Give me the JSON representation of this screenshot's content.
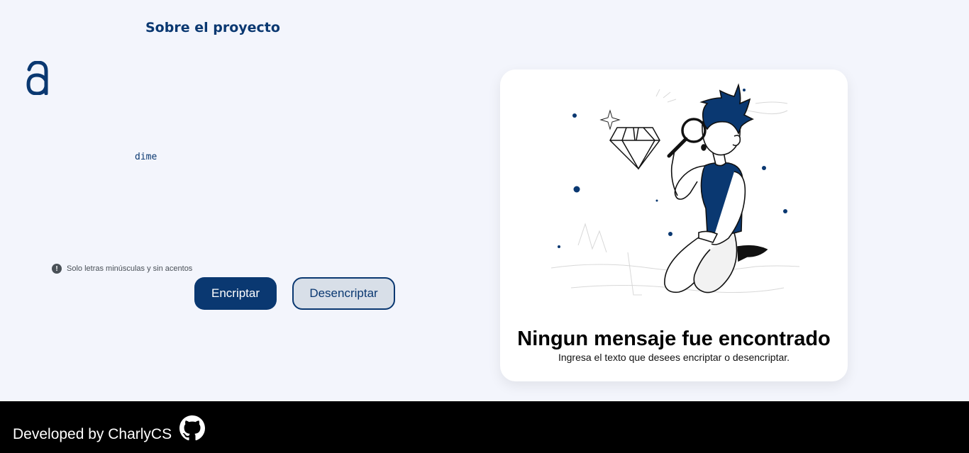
{
  "header": {
    "nav_link": "Sobre el proyecto",
    "logo_icon": "alura-logo-icon"
  },
  "input": {
    "value": "dime"
  },
  "hint": {
    "icon": "exclamation-circle-icon",
    "text": "Solo letras minúsculas y sin acentos"
  },
  "buttons": {
    "encrypt_label": "Encriptar",
    "decrypt_label": "Desencriptar"
  },
  "result": {
    "illustration": "person-with-magnifying-glass-and-diamond-illustration",
    "title": "Ningun mensaje fue encontrado",
    "subtitle": "Ingresa el texto que desees encriptar o desencriptar."
  },
  "footer": {
    "text": "Developed by CharlyCS",
    "icon": "github-icon"
  },
  "colors": {
    "brand": "#0a3871",
    "background": "#f3f5fc",
    "footer": "#000000"
  }
}
